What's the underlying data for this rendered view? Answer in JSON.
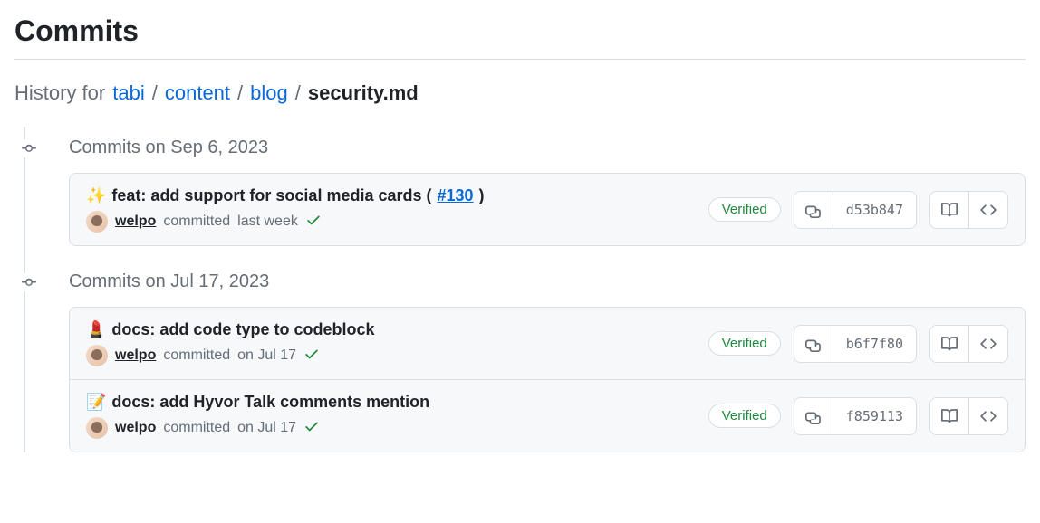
{
  "page_title": "Commits",
  "breadcrumb": {
    "prefix": "History for",
    "parts": [
      "tabi",
      "content",
      "blog"
    ],
    "current": "security.md"
  },
  "groups": [
    {
      "date_label": "Commits on Sep 6, 2023",
      "commits": [
        {
          "emoji": "✨",
          "title_prefix": "feat: add support for social media cards (",
          "pr": "#130",
          "title_suffix": ")",
          "author": "welpo",
          "committed_label": "committed",
          "time": "last week",
          "verified": "Verified",
          "sha": "d53b847"
        }
      ]
    },
    {
      "date_label": "Commits on Jul 17, 2023",
      "commits": [
        {
          "emoji": "💄",
          "title_prefix": "docs: add code type to codeblock",
          "pr": "",
          "title_suffix": "",
          "author": "welpo",
          "committed_label": "committed",
          "time": "on Jul 17",
          "verified": "Verified",
          "sha": "b6f7f80"
        },
        {
          "emoji": "📝",
          "title_prefix": "docs: add Hyvor Talk comments mention",
          "pr": "",
          "title_suffix": "",
          "author": "welpo",
          "committed_label": "committed",
          "time": "on Jul 17",
          "verified": "Verified",
          "sha": "f859113"
        }
      ]
    }
  ]
}
